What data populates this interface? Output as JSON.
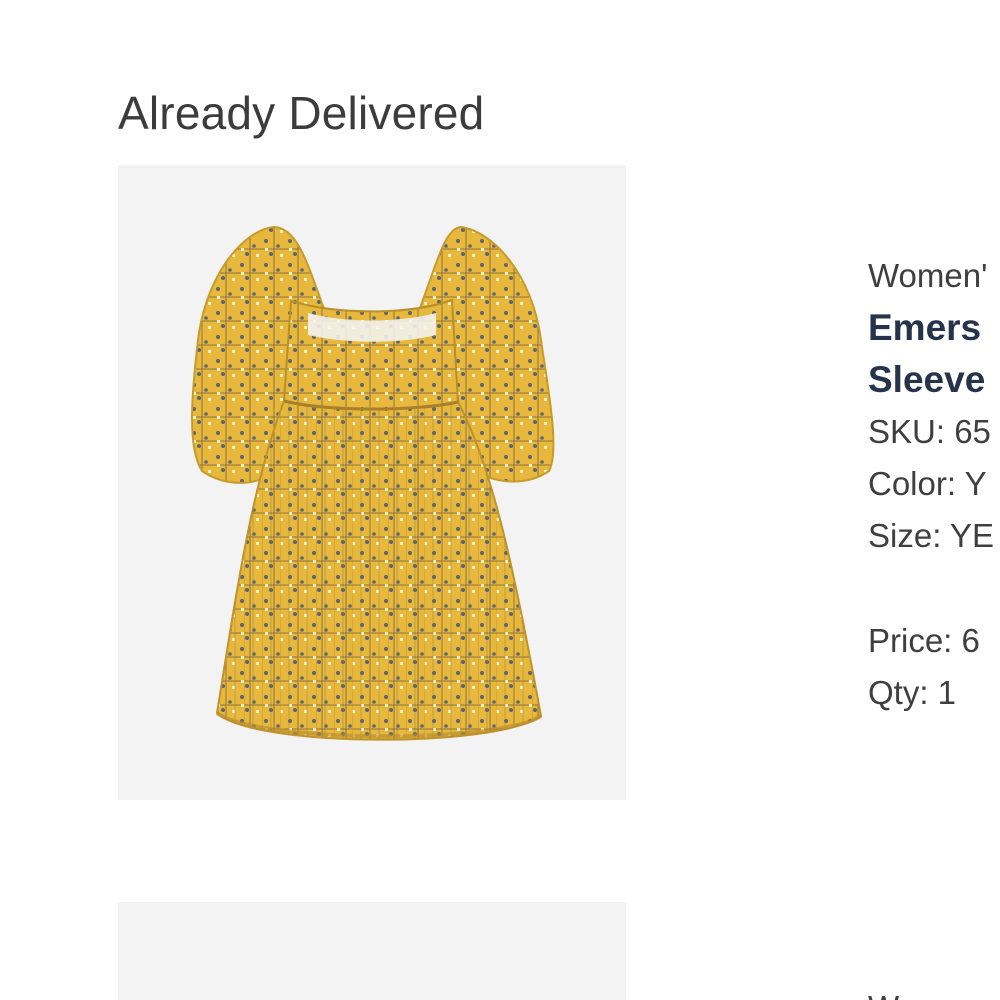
{
  "section": {
    "title": "Already Delivered"
  },
  "items": [
    {
      "category": "Women'",
      "name_line1": "Emers",
      "name_line2": "Sleeve",
      "sku": "SKU: 65",
      "color": "Color: Y",
      "size": "Size: YE",
      "price": "Price: 6",
      "qty": "Qty: 1",
      "image_icon": "yellow-printed-dress-image"
    },
    {
      "category": "W",
      "image_icon": "product-image"
    }
  ],
  "colors": {
    "dress_yellow": "#e7b83b",
    "dress_pattern": "#5f6670",
    "image_background": "#f3f3f3",
    "name_text": "#25344a"
  }
}
